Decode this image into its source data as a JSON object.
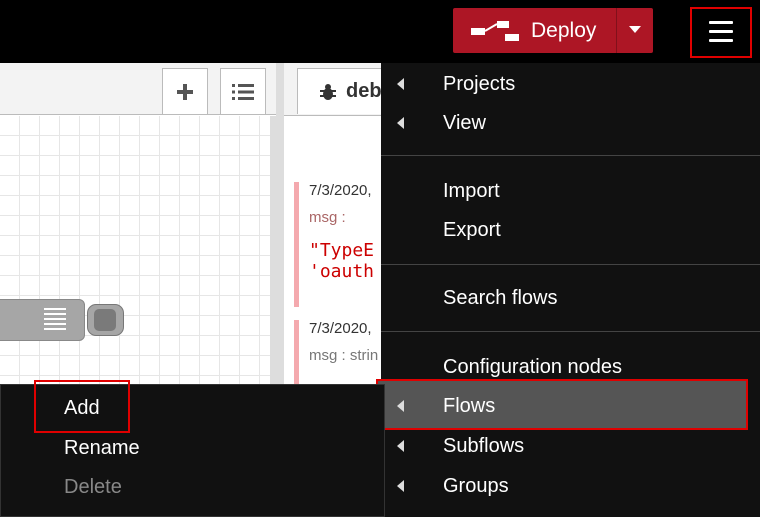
{
  "header": {
    "deploy_label": "Deploy",
    "accent_color": "#ad1625"
  },
  "workspace": {
    "add_tab_icon": "plus-icon",
    "list_tabs_icon": "list-icon"
  },
  "sidebar": {
    "debug_tab_label": "debu",
    "messages": [
      {
        "date": "7/3/2020,",
        "label": "msg :",
        "lines": [
          "\"TypeE",
          "'oauth"
        ]
      },
      {
        "date": "7/3/2020,",
        "label": "msg : strin"
      }
    ]
  },
  "main_menu": {
    "items": [
      {
        "label": "Projects",
        "submenu": true
      },
      {
        "label": "View",
        "submenu": true
      },
      {
        "label": "Import",
        "submenu": false
      },
      {
        "label": "Export",
        "submenu": false
      },
      {
        "label": "Search flows",
        "submenu": false
      },
      {
        "label": "Configuration nodes",
        "submenu": false
      },
      {
        "label": "Flows",
        "submenu": true,
        "active": true
      },
      {
        "label": "Subflows",
        "submenu": true
      },
      {
        "label": "Groups",
        "submenu": true
      }
    ]
  },
  "context_menu": {
    "items": [
      {
        "label": "Add",
        "enabled": true
      },
      {
        "label": "Rename",
        "enabled": true
      },
      {
        "label": "Delete",
        "enabled": false
      }
    ]
  }
}
